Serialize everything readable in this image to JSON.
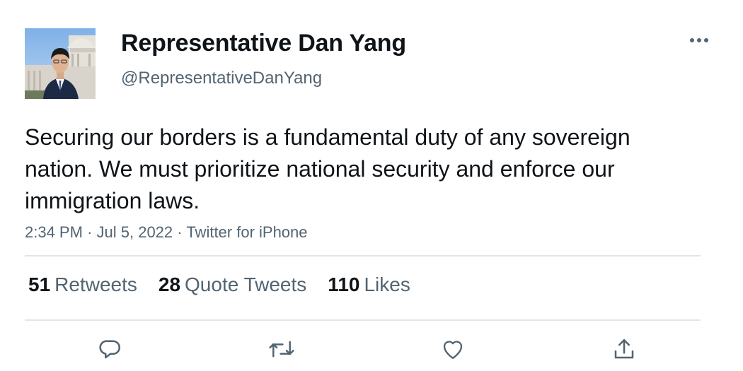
{
  "author": {
    "display_name": "Representative Dan Yang",
    "handle": "@RepresentativeDanYang",
    "avatar_icon": "profile-photo"
  },
  "tweet": {
    "text": "Securing our borders is a fundamental duty of any sovereign nation. We must prioritize national security and enforce our immigration laws.",
    "time": "2:34 PM",
    "date": "Jul 5, 2022",
    "source": "Twitter for iPhone",
    "separator": "·"
  },
  "stats": {
    "retweets": {
      "count": "51",
      "label": "Retweets"
    },
    "quote_tweets": {
      "count": "28",
      "label": "Quote Tweets"
    },
    "likes": {
      "count": "110",
      "label": "Likes"
    }
  },
  "actions": {
    "reply_icon": "reply-icon",
    "retweet_icon": "retweet-icon",
    "like_icon": "heart-icon",
    "share_icon": "share-icon"
  },
  "colors": {
    "text": "#0f1419",
    "secondary": "#536471",
    "divider": "#e1e6ea"
  }
}
